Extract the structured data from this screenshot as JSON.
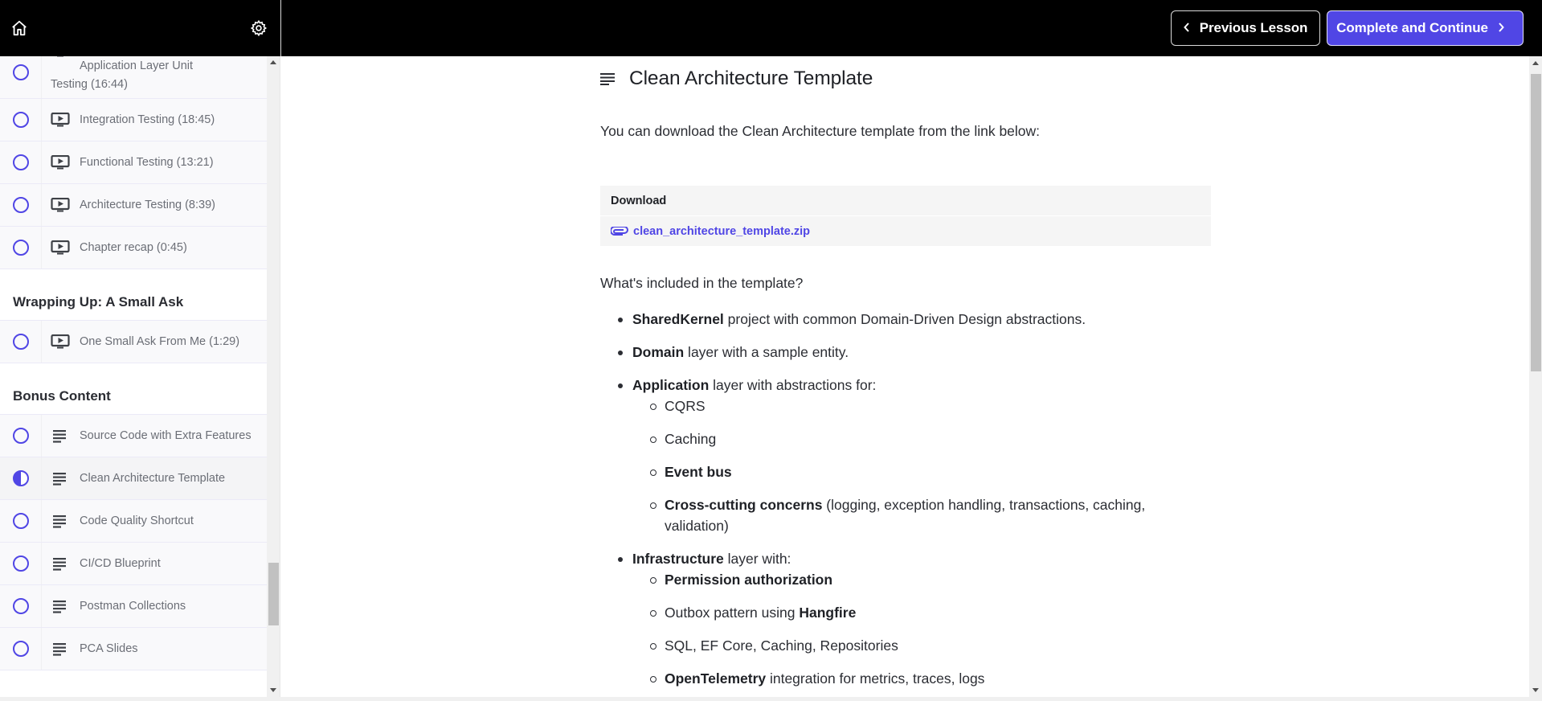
{
  "header": {
    "home_icon": "home-icon",
    "settings_icon": "gear-icon",
    "previous_label": "Previous Lesson",
    "complete_label": "Complete and Continue",
    "accent_color": "#5046e5"
  },
  "sidebar": {
    "items": [
      {
        "type": "lesson",
        "icon": "video-icon",
        "label": "Application Layer Unit Testing (16:44)",
        "status": "not-started"
      },
      {
        "type": "lesson",
        "icon": "video-icon",
        "label": "Integration Testing (18:45)",
        "status": "not-started"
      },
      {
        "type": "lesson",
        "icon": "video-icon",
        "label": "Functional Testing (13:21)",
        "status": "not-started"
      },
      {
        "type": "lesson",
        "icon": "video-icon",
        "label": "Architecture Testing (8:39)",
        "status": "not-started"
      },
      {
        "type": "lesson",
        "icon": "video-icon",
        "label": "Chapter recap (0:45)",
        "status": "not-started"
      },
      {
        "type": "section",
        "label": "Wrapping Up: A Small Ask"
      },
      {
        "type": "lesson",
        "icon": "video-icon",
        "label": "One Small Ask From Me (1:29)",
        "status": "not-started"
      },
      {
        "type": "section",
        "label": "Bonus Content"
      },
      {
        "type": "lesson",
        "icon": "text-icon",
        "label": "Source Code with Extra Features",
        "status": "not-started"
      },
      {
        "type": "lesson",
        "icon": "text-icon",
        "label": "Clean Architecture Template",
        "status": "in-progress",
        "active": true
      },
      {
        "type": "lesson",
        "icon": "text-icon",
        "label": "Code Quality Shortcut",
        "status": "not-started"
      },
      {
        "type": "lesson",
        "icon": "text-icon",
        "label": "CI/CD Blueprint",
        "status": "not-started"
      },
      {
        "type": "lesson",
        "icon": "text-icon",
        "label": "Postman Collections",
        "status": "not-started"
      },
      {
        "type": "lesson",
        "icon": "text-icon",
        "label": "PCA Slides",
        "status": "not-started"
      }
    ]
  },
  "lesson": {
    "title_icon": "text-icon",
    "title": "Clean Architecture Template",
    "intro": "You can download the Clean Architecture template from the link below:",
    "download": {
      "heading": "Download",
      "file_icon": "paperclip-icon",
      "file_name": "clean_architecture_template.zip"
    },
    "included_heading": "What's included in the template?",
    "list": [
      {
        "bold": "SharedKernel",
        "text": " project with common Domain-Driven Design abstractions."
      },
      {
        "bold": "Domain",
        "text": " layer with a sample entity."
      },
      {
        "bold": "Application",
        "text": " layer with abstractions for:",
        "children": [
          {
            "bold": "",
            "text": "CQRS"
          },
          {
            "bold": "",
            "text": "Caching"
          },
          {
            "bold": "Event bus",
            "text": ""
          },
          {
            "bold": "Cross-cutting concerns",
            "text": " (logging, exception handling, transactions, caching, validation)"
          }
        ]
      },
      {
        "bold": "Infrastructure",
        "text": " layer with:",
        "children": [
          {
            "bold": "Permission authorization",
            "text": ""
          },
          {
            "prefix": "Outbox pattern using ",
            "bold": "Hangfire",
            "text": ""
          },
          {
            "bold": "",
            "text": "SQL, EF Core, Caching, Repositories"
          },
          {
            "bold": "OpenTelemetry",
            "text": " integration for metrics, traces, logs"
          }
        ]
      }
    ]
  }
}
